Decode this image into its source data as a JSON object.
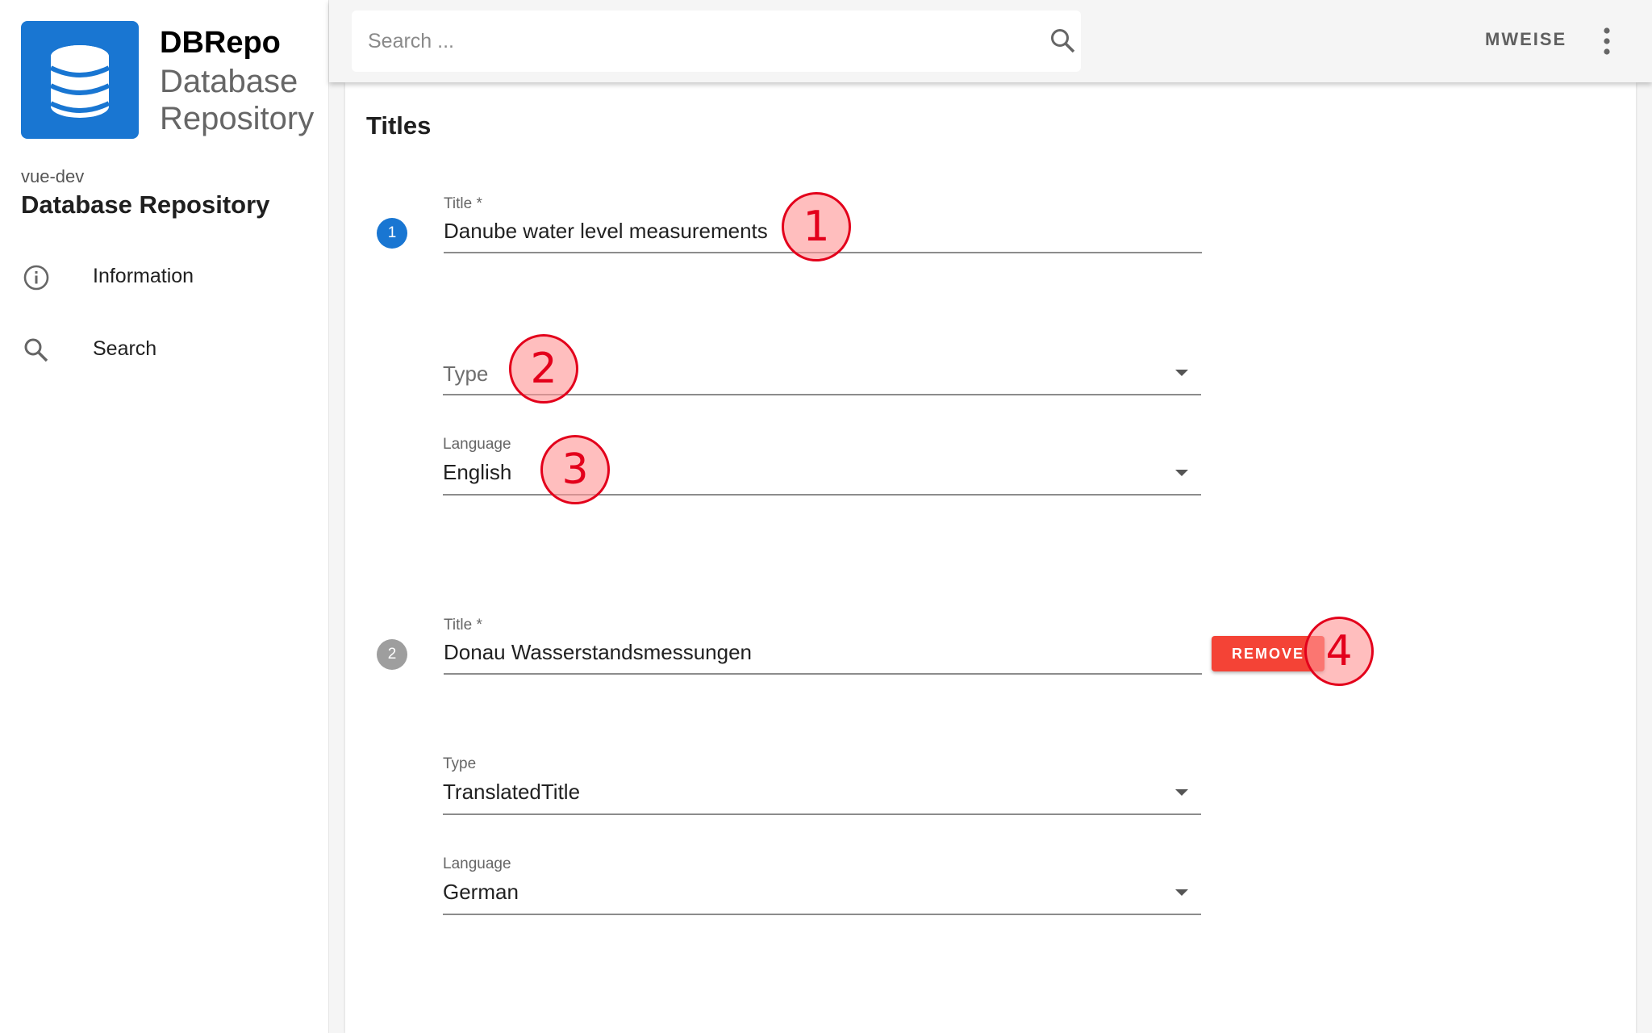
{
  "sidebar": {
    "brand_name": "DBRepo",
    "brand_subtitle": "Database Repository",
    "instance_name": "vue-dev",
    "repository_title": "Database Repository",
    "nav": [
      {
        "label": "Information",
        "icon": "info-circle-icon"
      },
      {
        "label": "Search",
        "icon": "search-icon"
      }
    ]
  },
  "topbar": {
    "search_placeholder": "Search ...",
    "user_label": "MWEISE",
    "menu_icon": "dots-vertical-icon"
  },
  "titles_section": {
    "heading": "Titles",
    "entries": [
      {
        "number": "1",
        "title_label": "Title *",
        "title_value": "Danube water level measurements",
        "type_label": "Type",
        "type_value": "",
        "language_label": "Language",
        "language_value": "English"
      },
      {
        "number": "2",
        "title_label": "Title *",
        "title_value": "Donau Wasserstandsmessungen",
        "remove_label": "REMOVE",
        "type_label": "Type",
        "type_value": "TranslatedTitle",
        "language_label": "Language",
        "language_value": "German"
      }
    ]
  },
  "annotation_markers": [
    "1",
    "2",
    "3",
    "4"
  ],
  "colors": {
    "primary": "#1976d2",
    "danger": "#f44336",
    "step_inactive": "#9e9e9e",
    "marker_stroke": "#e3001b"
  }
}
